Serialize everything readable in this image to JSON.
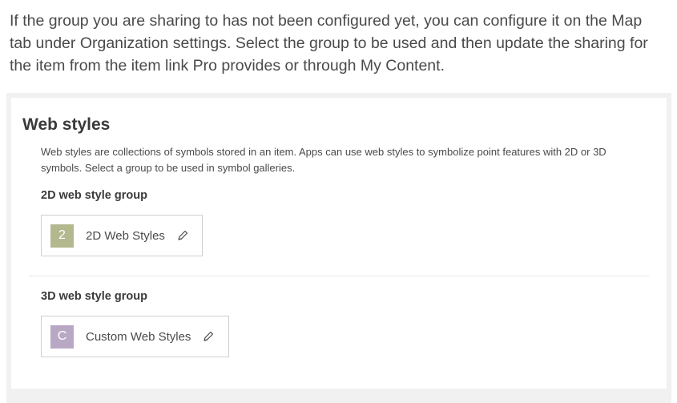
{
  "intro_text": "If the group you are sharing to has not been configured yet, you can configure it on the Map tab under Organization settings. Select the group to be used and then update the sharing for the item from the item link Pro provides or through My Content.",
  "web_styles": {
    "title": "Web styles",
    "description": "Web styles are collections of symbols stored in an item. Apps can use web styles to symbolize point features with 2D or 3D symbols. Select a group to be used in symbol galleries.",
    "group_2d": {
      "label": "2D web style group",
      "thumb_letter": "2",
      "thumb_color": "#b4b88e",
      "name": "2D Web Styles",
      "icon": "pencil-icon"
    },
    "group_3d": {
      "label": "3D web style group",
      "thumb_letter": "C",
      "thumb_color": "#b9a8c4",
      "name": "Custom Web Styles",
      "icon": "pencil-icon"
    }
  }
}
